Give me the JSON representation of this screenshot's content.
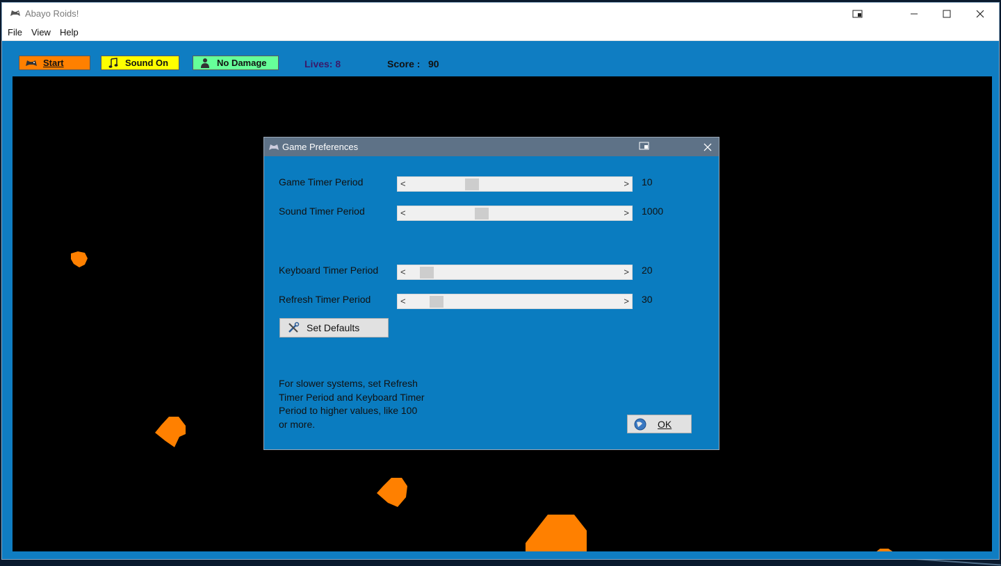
{
  "window": {
    "title": "Abayo Roids!",
    "menu": [
      "File",
      "View",
      "Help"
    ]
  },
  "toolbar": {
    "start_label": "Start",
    "sound_label": "Sound On",
    "damage_label": "No Damage",
    "lives_label": "Lives: 8",
    "score_label": "Score :",
    "score_value": "90"
  },
  "colors": {
    "start": "#ff8000",
    "sound": "#ffff00",
    "damage": "#66ff99",
    "lives_text": "#3a1a6a",
    "asteroid": "#ff8000"
  },
  "dialog": {
    "title": "Game Preferences",
    "rows": [
      {
        "label": "Game Timer Period",
        "value": "10"
      },
      {
        "label": "Sound Timer Period",
        "value": "1000"
      },
      {
        "label": "Keyboard Timer Period",
        "value": "20"
      },
      {
        "label": "Refresh Timer Period",
        "value": "30"
      }
    ],
    "set_defaults_label": "Set Defaults",
    "hint": "For slower systems, set Refresh Timer Period and Keyboard Timer Period to higher values, like 100 or more.",
    "ok_label": "OK"
  },
  "icons": {
    "app": "gamepad-icon",
    "start": "gamepad-icon",
    "sound": "music-note-icon",
    "damage": "person-icon",
    "set_defaults": "tools-icon",
    "ok": "globe-icon"
  }
}
